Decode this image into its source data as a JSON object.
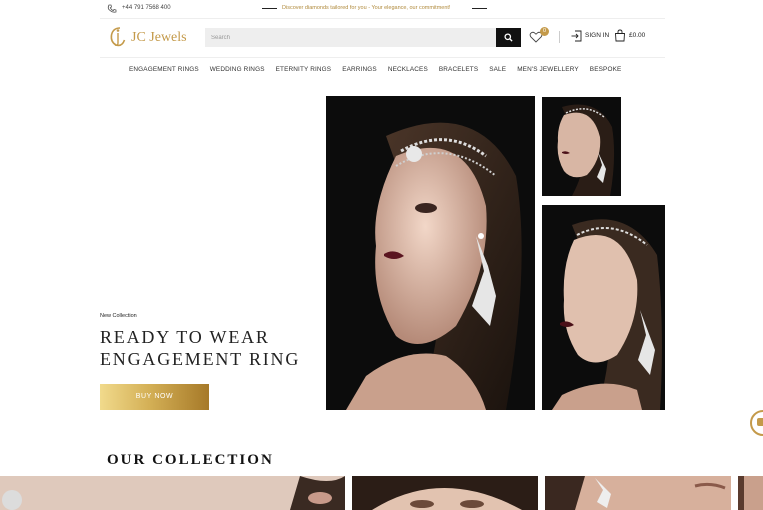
{
  "topbar": {
    "phone": "+44 791 7568 400",
    "promo": "Discover diamonds tailored for you - Your elegance, our commitment!"
  },
  "logo": {
    "text": "JC Jewels"
  },
  "search": {
    "placeholder": "Search",
    "value": ""
  },
  "header": {
    "wishlist_count": "0",
    "signin_label": "SIGN IN",
    "cart_total": "£0.00"
  },
  "nav": {
    "items": [
      {
        "label": "ENGAGEMENT RINGS"
      },
      {
        "label": "WEDDING RINGS"
      },
      {
        "label": "ETERNITY RINGS"
      },
      {
        "label": "EARRINGS"
      },
      {
        "label": "NECKLACES"
      },
      {
        "label": "BRACELETS"
      },
      {
        "label": "SALE"
      },
      {
        "label": "MEN'S JEWELLERY"
      },
      {
        "label": "BESPOKE"
      }
    ]
  },
  "hero": {
    "eyebrow": "New Collection",
    "title_line1": "READY TO WEAR",
    "title_line2": "ENGAGEMENT RING",
    "cta": "BUY NOW"
  },
  "collection": {
    "title": "OUR COLLECTION"
  },
  "colors": {
    "accent": "#c49a4a",
    "dark": "#111111",
    "search_bg": "#eeeeee"
  },
  "icons": [
    "phone-icon",
    "search-icon",
    "heart-icon",
    "signin-icon",
    "bag-icon",
    "chat-icon"
  ]
}
